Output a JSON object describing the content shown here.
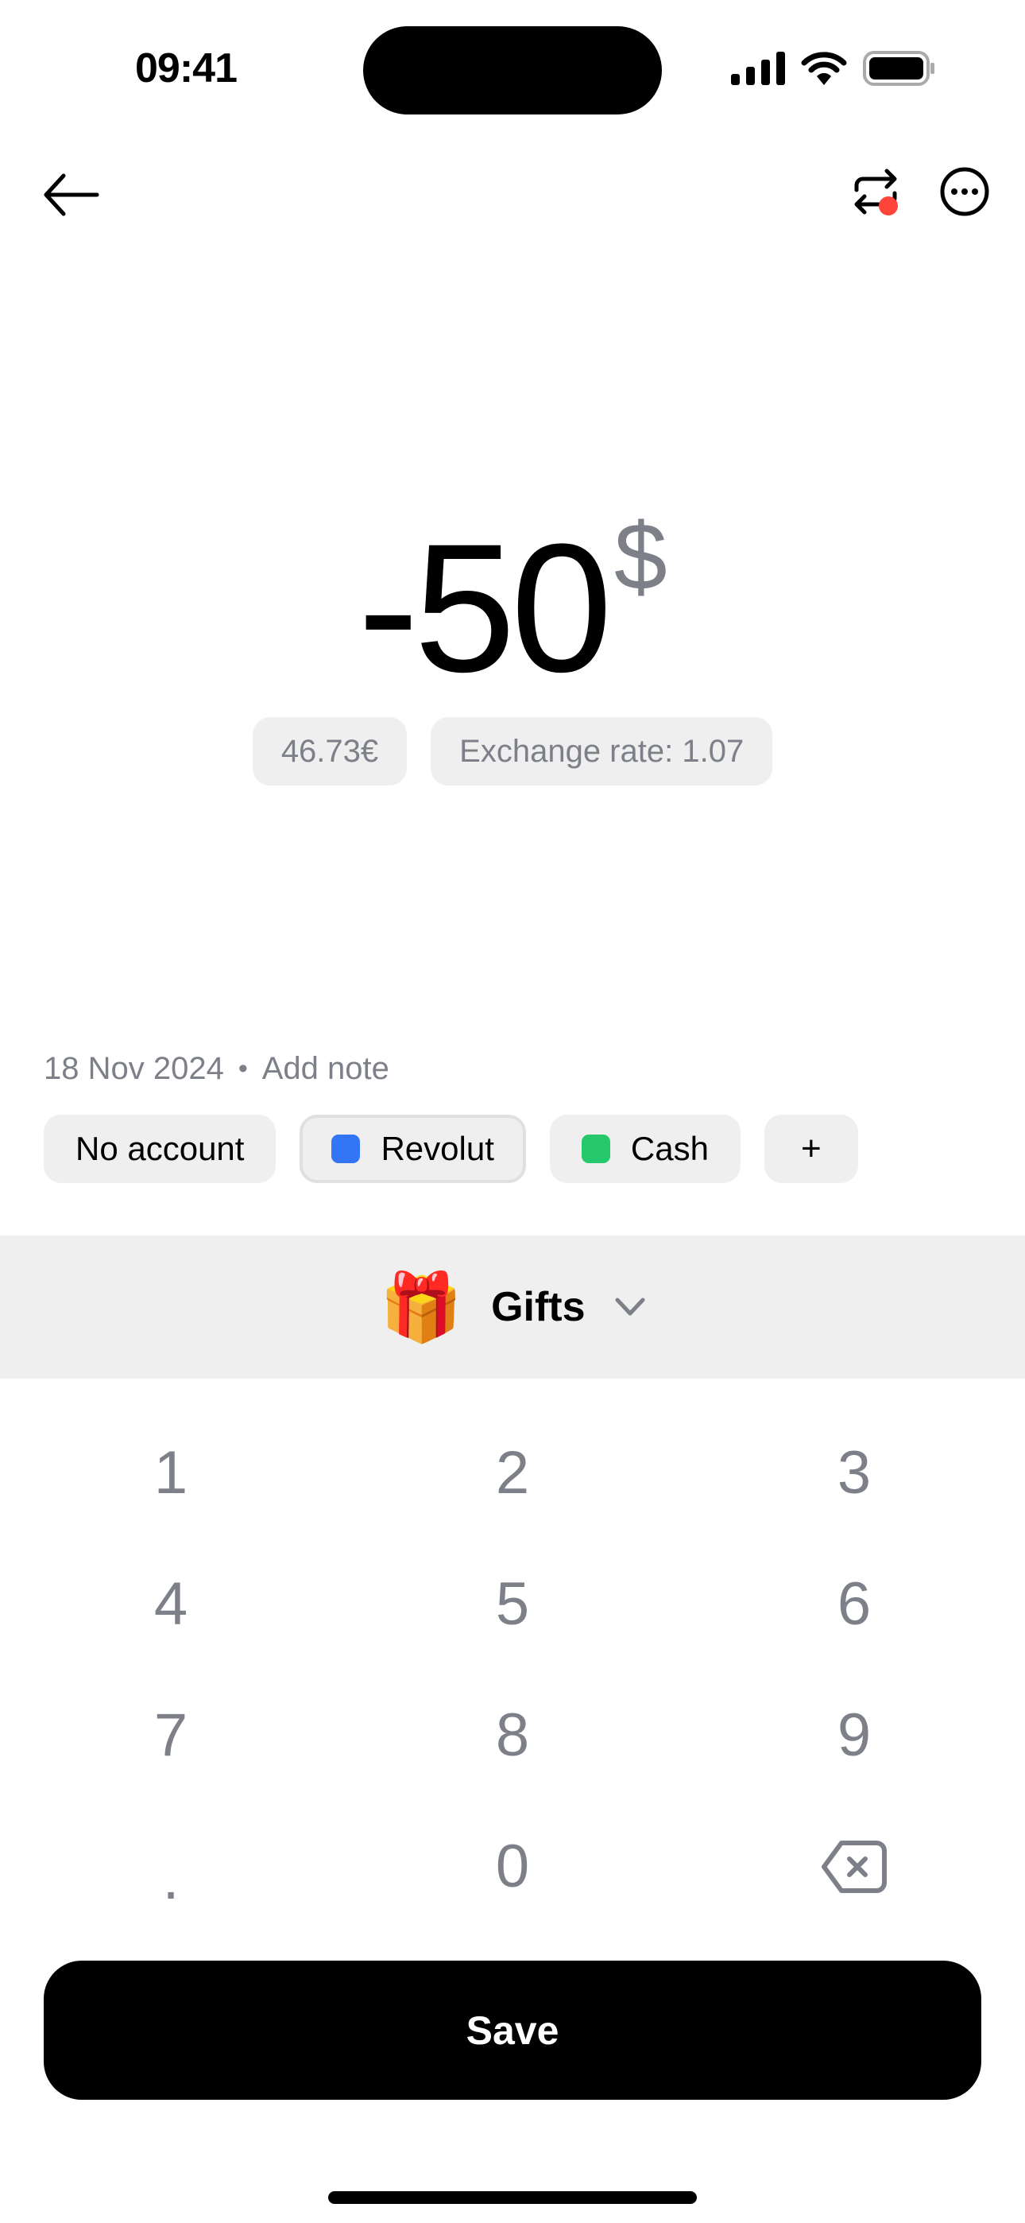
{
  "status_bar": {
    "time": "09:41"
  },
  "nav": {
    "back_icon": "arrow-left-icon",
    "recurring_icon": "repeat-icon",
    "recurring_badge_color": "#ff453a",
    "more_icon": "ellipsis-circle-icon"
  },
  "amount": {
    "value": "-50",
    "currency_symbol": "$",
    "converted": "46.73€",
    "exchange_rate": "Exchange rate: 1.07"
  },
  "meta": {
    "date": "18 Nov 2024",
    "separator": "•",
    "note_placeholder": "Add note"
  },
  "accounts": [
    {
      "label": "No account",
      "color": null,
      "selected": false
    },
    {
      "label": "Revolut",
      "color": "#3475f5",
      "selected": true
    },
    {
      "label": "Cash",
      "color": "#25c96b",
      "selected": false
    },
    {
      "label": "+",
      "color": null,
      "selected": false
    }
  ],
  "category": {
    "emoji": "🎁",
    "label": "Gifts",
    "icon": "chevron-down-icon"
  },
  "keypad": {
    "keys": [
      "1",
      "2",
      "3",
      "4",
      "5",
      "6",
      "7",
      "8",
      "9",
      ".",
      "0",
      "backspace"
    ]
  },
  "save_button": {
    "label": "Save"
  }
}
